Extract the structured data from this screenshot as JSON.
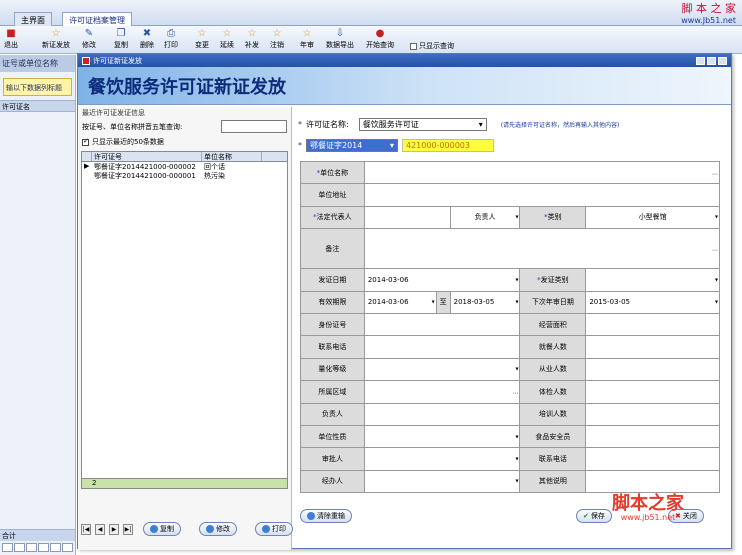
{
  "tabs": [
    {
      "label": "主界面"
    },
    {
      "label": "许可证档案管理"
    }
  ],
  "logo": {
    "line1": "脚 本 之 家",
    "line2": "www.Jb51.net"
  },
  "toolbar": {
    "items": [
      {
        "label": "退出"
      },
      {
        "label": "新证发放"
      },
      {
        "label": "修改"
      },
      {
        "label": "复制"
      },
      {
        "label": "删除"
      },
      {
        "label": "打印"
      },
      {
        "label": "变更"
      },
      {
        "label": "延续"
      },
      {
        "label": "补发"
      },
      {
        "label": "注销"
      },
      {
        "label": "年审"
      },
      {
        "label": "数据导出"
      },
      {
        "label": "开始查询"
      }
    ],
    "checkbox_label": "只显示查询"
  },
  "left_panel": {
    "header": "证号或单位名称",
    "yellow": "输以下数据列标题",
    "col_header": "许可证名",
    "footer": "合计"
  },
  "dialog": {
    "title": "许可证新证发放",
    "banner": "餐饮服务许可证新证发放",
    "left": {
      "section_title": "最近许可证发证信息",
      "query_label": "按证号、单位名称拼音五笔查询:",
      "checkbox_label": "只显示最近的50条数据",
      "grid_headers": [
        "许可证号",
        "单位名称"
      ],
      "grid_rows": [
        [
          "鄂餐证字2014421000-000002",
          "回个话"
        ],
        [
          "鄂餐证字2014421000-000001",
          "热污染"
        ]
      ],
      "grid_footer": "2",
      "buttons": {
        "copy": "复制",
        "edit": "修改",
        "print": "打印"
      }
    },
    "form": {
      "license_name_label": "许可证名称:",
      "license_name_value": "餐饮服务许可证",
      "hint": "(请先选择许可证名称，然后再输入其他内容)",
      "prefix_value": "鄂餐证字2014",
      "number_value": "421000-000003",
      "rows": {
        "unit_name": "单位名称",
        "unit_address": "单位地址",
        "legal_rep": "法定代表人",
        "responsible": "负责人",
        "category": "类别",
        "category_value": "小型餐馆",
        "remark": "备注",
        "issue_date": "发证日期",
        "issue_date_value": "2014-03-06",
        "issue_type": "发证类别",
        "valid_period": "有效期限",
        "valid_from": "2014-03-06",
        "to": "至",
        "valid_to": "2018-03-05",
        "next_review": "下次年审日期",
        "next_review_value": "2015-03-05",
        "id_number": "身份证号",
        "area": "经营面积",
        "phone": "联系电话",
        "diners": "就餐人数",
        "grade": "量化等级",
        "staff": "从业人数",
        "region": "所属区域",
        "exam": "体检人数",
        "person_in_charge": "负责人",
        "trained": "培训人数",
        "unit_nature": "单位性质",
        "food_safety": "食品安全员",
        "approver": "审批人",
        "contact_phone": "联系电话",
        "handler": "经办人",
        "other": "其他说明"
      }
    },
    "buttons": {
      "clear": "清除重输",
      "save": "保存",
      "close": "关闭"
    }
  },
  "watermark": {
    "line1": "脚本之家",
    "line2": "www.jb51.net"
  },
  "colors": {
    "banner_text": "#0d2b7a",
    "highlight_yellow": "#ffff40",
    "selection_blue": "#3c6fd0",
    "watermark": "#e63a2a"
  }
}
